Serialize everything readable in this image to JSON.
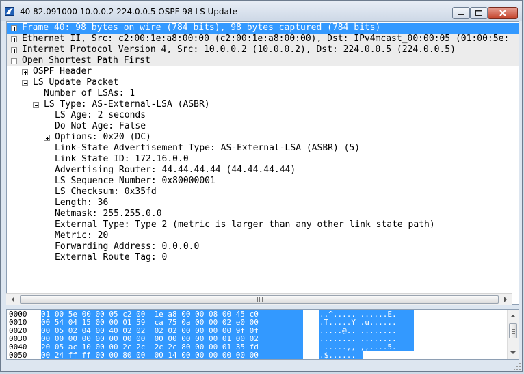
{
  "window": {
    "title": "40 82.091000 10.0.0.2 224.0.0.5 OSPF 98 LS Update",
    "icon": "wireshark-shark-fin-icon",
    "controls": [
      "minimize-icon",
      "maximize-icon",
      "close-icon"
    ]
  },
  "details": {
    "rows": [
      {
        "text": "Frame 40: 98 bytes on wire (784 bits), 98 bytes captured (784 bits)",
        "expander": "plus",
        "selected": true
      },
      {
        "text": "Ethernet II, Src: c2:00:1e:a8:00:00 (c2:00:1e:a8:00:00), Dst: IPv4mcast_00:00:05 (01:00:5e:",
        "expander": "plus"
      },
      {
        "text": "Internet Protocol Version 4, Src: 10.0.0.2 (10.0.0.2), Dst: 224.0.0.5 (224.0.0.5)",
        "expander": "plus"
      },
      {
        "text": "Open Shortest Path First",
        "expander": "minus"
      },
      {
        "text": "OSPF Header",
        "expander": "plus"
      },
      {
        "text": "LS Update Packet",
        "expander": "minus"
      },
      {
        "text": "Number of LSAs: 1",
        "expander": "none"
      },
      {
        "text": "LS Type: AS-External-LSA (ASBR)",
        "expander": "minus"
      },
      {
        "text": "LS Age: 2 seconds",
        "expander": "none"
      },
      {
        "text": "Do Not Age: False",
        "expander": "none"
      },
      {
        "text": "Options: 0x20 (DC)",
        "expander": "plus"
      },
      {
        "text": "Link-State Advertisement Type: AS-External-LSA (ASBR) (5)",
        "expander": "none"
      },
      {
        "text": "Link State ID: 172.16.0.0",
        "expander": "none"
      },
      {
        "text": "Advertising Router: 44.44.44.44 (44.44.44.44)",
        "expander": "none"
      },
      {
        "text": "LS Sequence Number: 0x80000001",
        "expander": "none"
      },
      {
        "text": "LS Checksum: 0x35fd",
        "expander": "none"
      },
      {
        "text": "Length: 36",
        "expander": "none"
      },
      {
        "text": "Netmask: 255.255.0.0",
        "expander": "none"
      },
      {
        "text": "External Type: Type 2 (metric is larger than any other link state path)",
        "expander": "none"
      },
      {
        "text": "Metric: 20",
        "expander": "none"
      },
      {
        "text": "Forwarding Address: 0.0.0.0",
        "expander": "none"
      },
      {
        "text": "External Route Tag: 0",
        "expander": "none"
      }
    ]
  },
  "bytes": {
    "rows": [
      {
        "offset": "0000",
        "hex": "01 00 5e 00 00 05 c2 00  1e a8 00 00 08 00 45 c0",
        "ascii": "..^..... ......E."
      },
      {
        "offset": "0010",
        "hex": "00 54 04 15 00 00 01 59  ca 75 0a 00 00 02 e0 00",
        "ascii": ".T.....Y .u......"
      },
      {
        "offset": "0020",
        "hex": "00 05 02 04 00 40 02 02  02 02 00 00 00 00 9f 0f",
        "ascii": ".....@.. ........"
      },
      {
        "offset": "0030",
        "hex": "00 00 00 00 00 00 00 00  00 00 00 00 00 01 00 02",
        "ascii": "........ ........"
      },
      {
        "offset": "0040",
        "hex": "20 05 ac 10 00 00 2c 2c  2c 2c 80 00 00 01 35 fd",
        "ascii": " .....,, ,,....5."
      },
      {
        "offset": "0050",
        "hex": "00 24 ff ff 00 00 80 00  00 14 00 00 00 00 00 00",
        "ascii": ".$......"
      }
    ]
  },
  "colors": {
    "selection": "#3399ff",
    "shaded_row": "#ececec"
  }
}
